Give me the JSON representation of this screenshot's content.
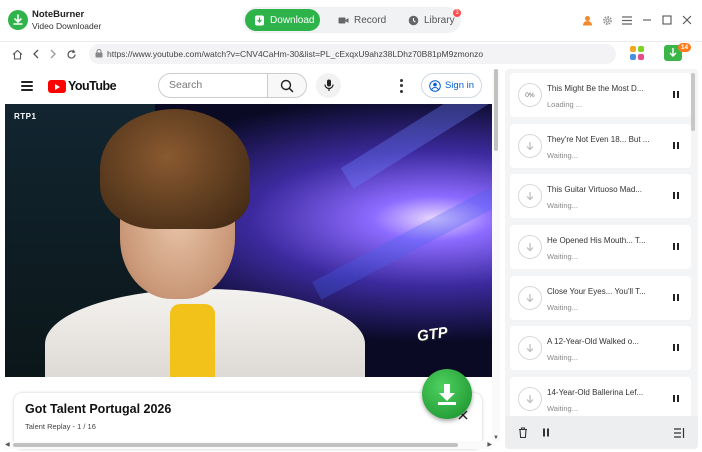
{
  "app": {
    "name": "NoteBurner",
    "subtitle": "Video Downloader"
  },
  "nav": {
    "download": "Download",
    "record": "Record",
    "library": "Library",
    "library_badge": "3"
  },
  "address": {
    "url": "https://www.youtube.com/watch?v=CNV4CaHm-30&list=PL_cExqxU9ahz38LDhz70B81pM9zmonzo",
    "extension_badge": "14"
  },
  "youtube": {
    "logo_text": "YouTube",
    "search_placeholder": "Search",
    "sign_in": "Sign in"
  },
  "video": {
    "channel_watermark": "RTP1",
    "show_watermark": "GTP",
    "title": "Got Talent Portugal 2026",
    "subtitle": "Talent Replay - 1 / 16"
  },
  "queue": {
    "items": [
      {
        "title": "This Might Be the Most D...",
        "status": "Loading ...",
        "progress": "0%"
      },
      {
        "title": "They're Not Even 18... But ...",
        "status": "Waiting..."
      },
      {
        "title": "This Guitar Virtuoso Mad...",
        "status": "Waiting..."
      },
      {
        "title": "He Opened His Mouth... T...",
        "status": "Waiting..."
      },
      {
        "title": "Close Your Eyes... You'll T...",
        "status": "Waiting..."
      },
      {
        "title": "A 12-Year-Old Walked o...",
        "status": "Waiting..."
      },
      {
        "title": "14-Year-Old Ballerina Lef...",
        "status": "Waiting..."
      }
    ]
  },
  "colors": {
    "accent": "#2eb34b",
    "youtube_red": "#ff0000",
    "link_blue": "#065fd4",
    "badge_red": "#ff4b4b",
    "ext_orange": "#ff7a1a"
  }
}
